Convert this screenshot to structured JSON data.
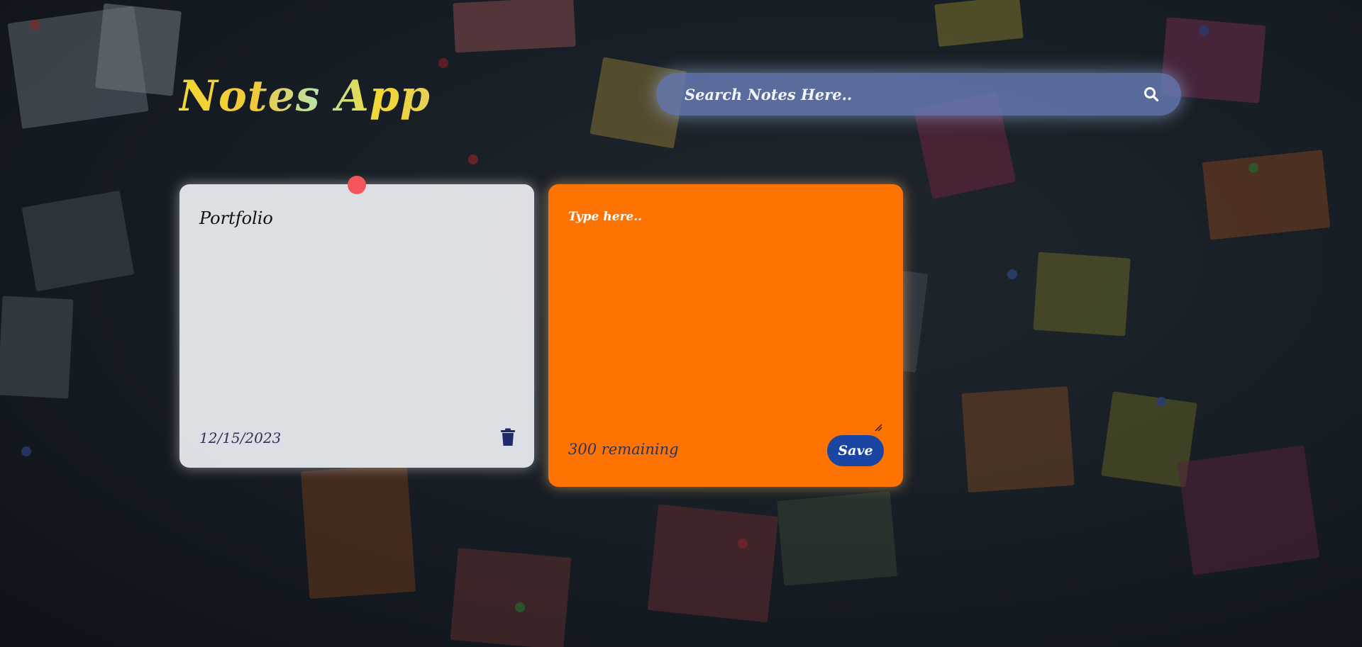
{
  "app": {
    "title": "Notes App"
  },
  "search": {
    "placeholder": "Search Notes Here..",
    "icon": "search-icon"
  },
  "notes": [
    {
      "title": "Portfolio",
      "date": "12/15/2023",
      "delete_icon": "trash-icon",
      "pin_color": "#f2555a",
      "background": "#eceef2"
    }
  ],
  "add_note": {
    "placeholder": "Type here..",
    "remaining_text": "300 remaining",
    "save_label": "Save",
    "background": "#ff7303",
    "button_color": "#1a45a3"
  },
  "colors": {
    "title_gradient_start": "#f3d832",
    "title_gradient_mid": "#b9e3a8",
    "search_bg": "#687db6",
    "date_text": "#2c3357"
  }
}
